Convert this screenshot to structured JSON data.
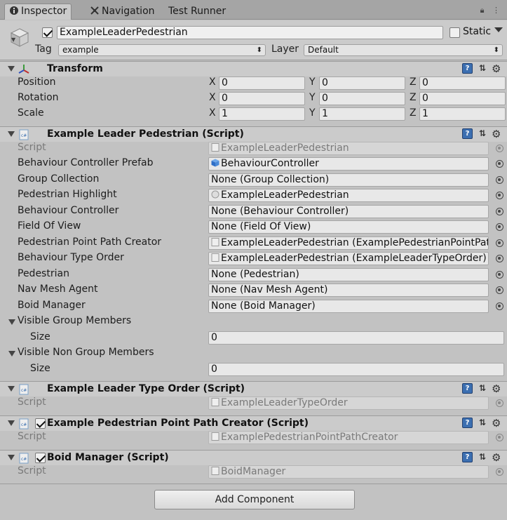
{
  "tabs": [
    {
      "label": "Inspector",
      "icon": "info-icon"
    },
    {
      "label": "Navigation",
      "icon": "navigation-icon"
    },
    {
      "label": "Test Runner"
    }
  ],
  "header": {
    "object_name": "ExampleLeaderPedestrian",
    "active": true,
    "static_label": "Static",
    "tag_label": "Tag",
    "tag_value": "example",
    "layer_label": "Layer",
    "layer_value": "Default"
  },
  "transform": {
    "title": "Transform",
    "rows": [
      {
        "label": "Position",
        "x": "0",
        "y": "0",
        "z": "0"
      },
      {
        "label": "Rotation",
        "x": "0",
        "y": "0",
        "z": "0"
      },
      {
        "label": "Scale",
        "x": "1",
        "y": "1",
        "z": "1"
      }
    ],
    "axis": {
      "x": "X",
      "y": "Y",
      "z": "Z"
    }
  },
  "leader_script": {
    "title": "Example Leader Pedestrian (Script)",
    "props": [
      {
        "label": "Script",
        "value": "ExampleLeaderPedestrian"
      },
      {
        "label": "Behaviour Controller Prefab",
        "value": "BehaviourController"
      },
      {
        "label": "Group Collection",
        "value": "None (Group Collection)"
      },
      {
        "label": "Pedestrian Highlight",
        "value": "ExampleLeaderPedestrian"
      },
      {
        "label": "Behaviour Controller",
        "value": "None (Behaviour Controller)"
      },
      {
        "label": "Field Of View",
        "value": "None (Field Of View)"
      },
      {
        "label": "Pedestrian Point Path Creator",
        "value": "ExampleLeaderPedestrian (ExamplePedestrianPointPat"
      },
      {
        "label": "Behaviour Type Order",
        "value": "ExampleLeaderPedestrian (ExampleLeaderTypeOrder)"
      },
      {
        "label": "Pedestrian",
        "value": "None (Pedestrian)"
      },
      {
        "label": "Nav Mesh Agent",
        "value": "None (Nav Mesh Agent)"
      },
      {
        "label": "Boid Manager",
        "value": "None (Boid Manager)"
      }
    ],
    "visible_group": {
      "label": "Visible Group Members",
      "size_label": "Size",
      "size": "0"
    },
    "visible_non_group": {
      "label": "Visible Non Group Members",
      "size_label": "Size",
      "size": "0"
    }
  },
  "type_order": {
    "title": "Example Leader Type Order (Script)",
    "script_label": "Script",
    "script_value": "ExampleLeaderTypeOrder"
  },
  "path_creator": {
    "title": "Example Pedestrian Point Path Creator (Script)",
    "script_label": "Script",
    "script_value": "ExamplePedestrianPointPathCreator"
  },
  "boid": {
    "title": "Boid Manager (Script)",
    "script_label": "Script",
    "script_value": "BoidManager"
  },
  "add_component": "Add Component",
  "colors": {
    "help_blue": "#3c6fb1",
    "tab_bar": "#a5a5a5",
    "panel": "#c2c2c2"
  }
}
